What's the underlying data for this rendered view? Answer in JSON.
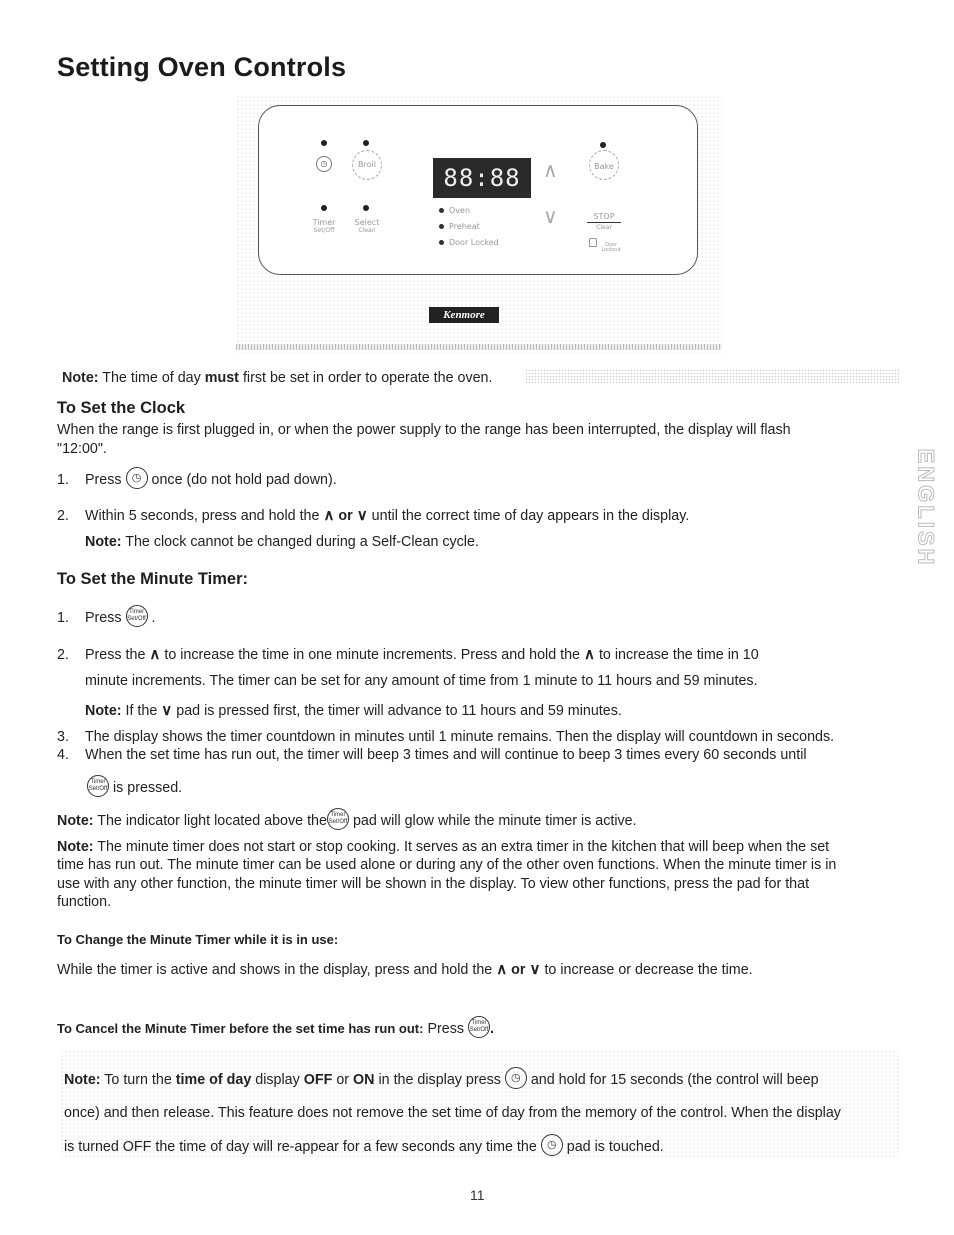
{
  "page": {
    "title": "Setting Oven Controls",
    "page_number": "11",
    "side_tab": "ENGLISH"
  },
  "panel": {
    "display": "88:88",
    "pads": {
      "clock_icon": "clock-icon",
      "clock_glyph": "◷",
      "broil": "Broil",
      "bake": "Bake",
      "timer_line1": "Timer",
      "timer_line2": "Set/Off",
      "select_line1": "Select",
      "select_line2": "Clean",
      "stop_line1": "STOP",
      "stop_line2": "Clear",
      "lockout_line1": "Door",
      "lockout_line2": "Lockout",
      "up_glyph": "∧",
      "down_glyph": "∨"
    },
    "indicators": [
      "Oven",
      "Preheat",
      "Door Locked"
    ],
    "brand": "Kenmore"
  },
  "note_top": {
    "label": "Note:",
    "pre": "The time of day",
    "bold": "must",
    "post": "first be set in order to operate the oven."
  },
  "set_clock": {
    "heading": "To Set the Clock",
    "intro_line1": "When the range is first plugged in, or when the power supply to the range has been interrupted, the display will flash",
    "intro_line2": "\"12:00\".",
    "step1": {
      "num": "1.",
      "pre": "Press",
      "post": "once (do not hold pad down)."
    },
    "step2": {
      "num": "2.",
      "pre": "Within 5 seconds, press and hold the",
      "or": "or",
      "post": "until the correct time of day appears in the display."
    },
    "note": {
      "label": "Note:",
      "text": "The clock cannot be changed during a Self-Clean cycle."
    }
  },
  "minute_timer": {
    "heading": "To Set the Minute Timer:",
    "timer_icon_line1": "Timer",
    "timer_icon_line2": "Set/Off",
    "step1": {
      "num": "1.",
      "pre": "Press",
      "post": "."
    },
    "step2": {
      "num": "2.",
      "a": "Press the",
      "b": "to increase the time in one minute increments. Press and hold the",
      "c": "to increase the time in 10",
      "line2": "minute increments. The timer can be set for any amount of time from 1 minute to 11 hours and 59 minutes."
    },
    "step2_note": {
      "label": "Note:",
      "pre": "If the",
      "post": "pad is pressed first, the timer will advance to 11 hours and 59 minutes."
    },
    "step3": {
      "num": "3.",
      "text": "The display shows the timer countdown in minutes until 1 minute remains. Then the display will countdown in seconds."
    },
    "step4": {
      "num": "4.",
      "text": "When the set time has run out, the timer will beep 3 times and will continue to beep 3 times every 60 seconds until",
      "line2": "is pressed."
    },
    "note1": {
      "label": "Note:",
      "pre": "The indicator light located above the",
      "post": "pad will glow while the minute timer is active."
    },
    "note2": {
      "label": "Note:",
      "line1": "The minute timer does not start or stop cooking. It serves as an extra timer in the kitchen that will beep when the set",
      "line2": "time has run out. The minute timer can be used alone or during any of the other oven functions. When the minute timer is in",
      "line3": "use with any other function, the minute timer will be shown in the display. To view other functions, press the pad for that",
      "line4": "function."
    }
  },
  "change_timer": {
    "heading": "To Change the Minute Timer while it is in use:",
    "pre": "While the timer is active and shows in the display, press and hold the",
    "or": "or",
    "post": "to increase or decrease the time."
  },
  "cancel_timer": {
    "heading": "To Cancel the Minute Timer before the set time has run out:",
    "press": "Press",
    "end": "."
  },
  "note_bottom": {
    "label": "Note:",
    "a": "To turn the",
    "b_bold": "time of day",
    "c": "display",
    "d_bold": "OFF",
    "e": "or",
    "f_bold": "ON",
    "g": "in the display press",
    "h": "and hold for 15 seconds (the control will beep",
    "line2": "once) and then release. This feature does not remove the set time of day from the memory of the control. When the display",
    "line3_pre": "is turned OFF the time of day will re-appear for a few seconds any time the",
    "line3_post": "pad is touched."
  }
}
